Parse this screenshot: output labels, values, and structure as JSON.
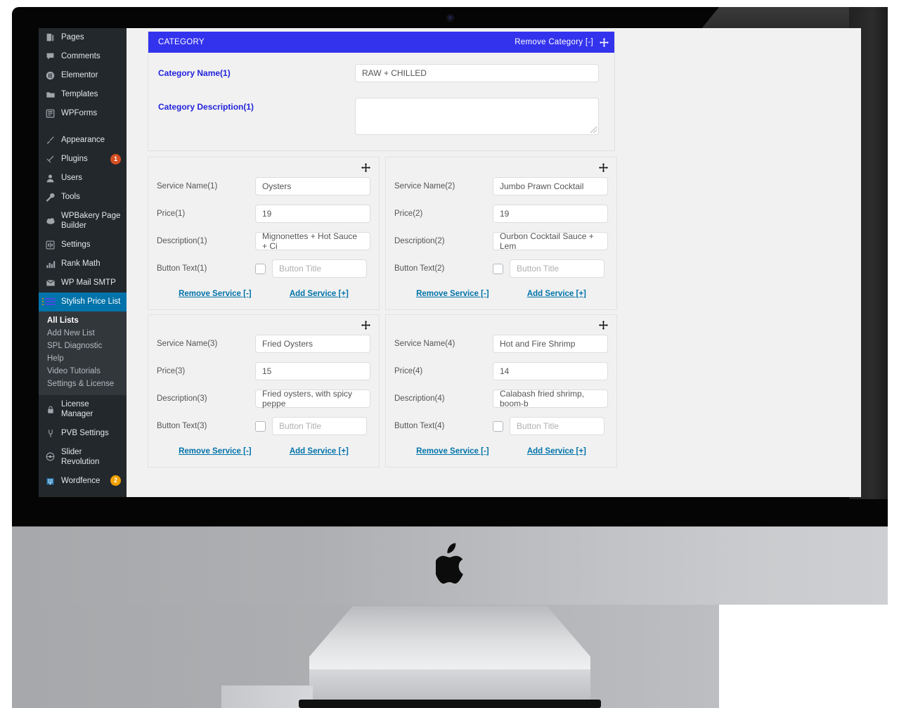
{
  "sidebar": {
    "items": [
      {
        "label": "Pages",
        "icon": "pages-icon",
        "glyph": "▤"
      },
      {
        "label": "Comments",
        "icon": "comments-icon",
        "glyph": "🗩"
      },
      {
        "label": "Elementor",
        "icon": "elementor-icon",
        "glyph": "ⓔ"
      },
      {
        "label": "Templates",
        "icon": "folder-icon",
        "glyph": "🗀"
      },
      {
        "label": "WPForms",
        "icon": "wpforms-icon",
        "glyph": "▦"
      }
    ],
    "items2": [
      {
        "label": "Appearance",
        "icon": "brush-icon",
        "glyph": "🖌"
      },
      {
        "label": "Plugins",
        "icon": "plug-icon",
        "glyph": "🔌",
        "badge": "1"
      },
      {
        "label": "Users",
        "icon": "user-icon",
        "glyph": "👤"
      },
      {
        "label": "Tools",
        "icon": "wrench-icon",
        "glyph": "🔧"
      },
      {
        "label": "WPBakery Page Builder",
        "icon": "cloud-icon",
        "glyph": "☁"
      },
      {
        "label": "Settings",
        "icon": "sliders-icon",
        "glyph": "⊞"
      },
      {
        "label": "Rank Math",
        "icon": "chart-icon",
        "glyph": "▂▄▆"
      },
      {
        "label": "WP Mail SMTP",
        "icon": "mail-icon",
        "glyph": "✉"
      }
    ],
    "current": {
      "label": "Stylish Price List",
      "icon": "stylish-price-list-icon"
    },
    "submenu": [
      {
        "label": "All Lists",
        "active": true
      },
      {
        "label": "Add New List",
        "active": false
      },
      {
        "label": "SPL Diagnostic",
        "active": false
      },
      {
        "label": "Help",
        "active": false
      },
      {
        "label": "Video Tutorials",
        "active": false
      },
      {
        "label": "Settings & License",
        "active": false
      }
    ],
    "items3": [
      {
        "label": "License Manager",
        "icon": "lock-icon",
        "glyph": "🔒"
      },
      {
        "label": "PVB Settings",
        "icon": "pvb-icon",
        "glyph": "⎓"
      },
      {
        "label": "Slider Revolution",
        "icon": "slider-revolution-icon",
        "glyph": "◉"
      },
      {
        "label": "Wordfence",
        "icon": "wordfence-icon",
        "glyph": "🏛",
        "badge": "2"
      }
    ]
  },
  "category": {
    "header_title": "CATEGORY",
    "remove_label": "Remove Category [-]",
    "move_icon": "move-handle-icon",
    "name_label": "Category Name(1)",
    "name_value": "RAW + CHILLED",
    "description_label": "Category Description(1)",
    "description_value": ""
  },
  "services": [
    {
      "name_label": "Service Name(1)",
      "name_value": "Oysters",
      "price_label": "Price(1)",
      "price_value": "19",
      "desc_label": "Description(1)",
      "desc_value": "Mignonettes + Hot Sauce + Ci",
      "button_label": "Button Text(1)",
      "button_placeholder": "Button Title",
      "button_value": "",
      "remove_label": "Remove Service [-]",
      "add_label": "Add Service [+]"
    },
    {
      "name_label": "Service Name(2)",
      "name_value": "Jumbo Prawn Cocktail",
      "price_label": "Price(2)",
      "price_value": "19",
      "desc_label": "Description(2)",
      "desc_value": "Ourbon Cocktail Sauce + Lem",
      "button_label": "Button Text(2)",
      "button_placeholder": "Button Title",
      "button_value": "",
      "remove_label": "Remove Service [-]",
      "add_label": "Add Service [+]"
    },
    {
      "name_label": "Service Name(3)",
      "name_value": "Fried Oysters",
      "price_label": "Price(3)",
      "price_value": "15",
      "desc_label": "Description(3)",
      "desc_value": "Fried oysters, with spicy peppe",
      "button_label": "Button Text(3)",
      "button_placeholder": "Button Title",
      "button_value": "",
      "remove_label": "Remove Service [-]",
      "add_label": "Add Service [+]"
    },
    {
      "name_label": "Service Name(4)",
      "name_value": "Hot and Fire Shrimp",
      "price_label": "Price(4)",
      "price_value": "14",
      "desc_label": "Description(4)",
      "desc_value": "Calabash fried shrimp, boom-b",
      "button_label": "Button Text(4)",
      "button_placeholder": "Button Title",
      "button_value": "",
      "remove_label": "Remove Service [-]",
      "add_label": "Add Service [+]"
    }
  ],
  "device": {
    "logo": "apple-logo-icon",
    "camera": "webcam-icon"
  },
  "colors": {
    "category_header": "#3333ee",
    "category_label": "#2323dd",
    "link": "#0073aa",
    "sidebar_bg": "#23282d",
    "submenu_bg": "#32373c",
    "badge_red": "#d54e21",
    "badge_orange": "#f0a000"
  }
}
